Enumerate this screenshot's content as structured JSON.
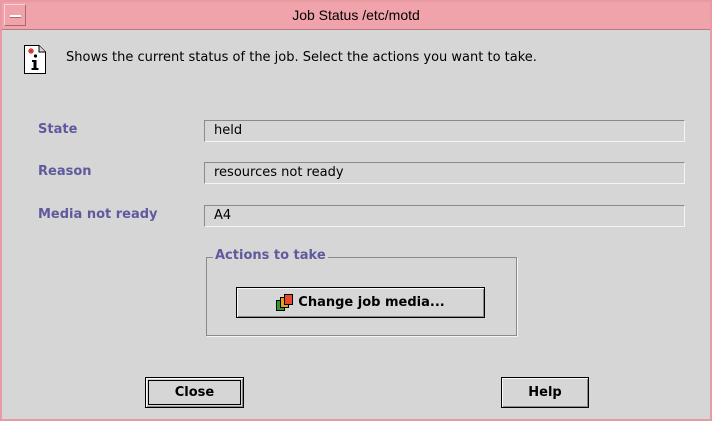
{
  "window": {
    "title": "Job Status /etc/motd"
  },
  "info": {
    "icon": "info-icon",
    "description": "Shows the current status of the job. Select the actions you want to take."
  },
  "fields": [
    {
      "label": "State",
      "value": "held"
    },
    {
      "label": "Reason",
      "value": "resources not ready"
    },
    {
      "label": "Media not ready",
      "value": "A4"
    }
  ],
  "actions": {
    "group_label": "Actions to take",
    "change_media_label": "Change job media...",
    "change_media_icon": "media-pages-icon"
  },
  "buttons": {
    "close_label": "Close",
    "help_label": "Help"
  },
  "colors": {
    "titlebar": "#f0a3aa",
    "label_text": "#5f5a9e",
    "window_bg": "#d6d6d6"
  }
}
